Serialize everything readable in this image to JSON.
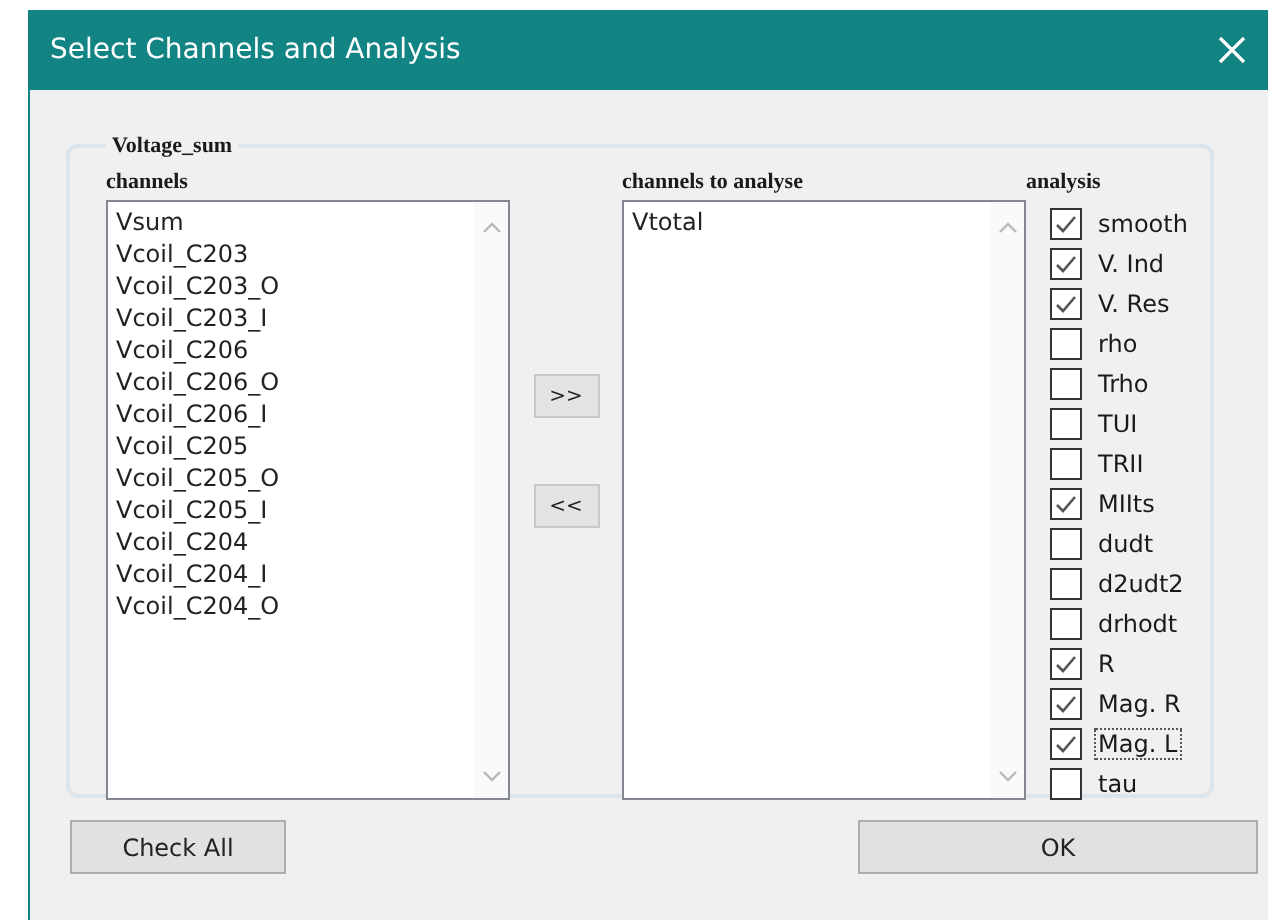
{
  "window": {
    "title": "Select Channels and Analysis"
  },
  "group": {
    "title": "Voltage_sum"
  },
  "channels": {
    "label": "channels",
    "items": [
      "Vsum",
      "Vcoil_C203",
      "Vcoil_C203_O",
      "Vcoil_C203_I",
      "Vcoil_C206",
      "Vcoil_C206_O",
      "Vcoil_C206_I",
      "Vcoil_C205",
      "Vcoil_C205_O",
      "Vcoil_C205_I",
      "Vcoil_C204",
      "Vcoil_C204_I",
      "Vcoil_C204_O"
    ]
  },
  "move_buttons": [
    ">>",
    "<<"
  ],
  "channels_to_analyse": {
    "label": "channels to analyse",
    "items": [
      "Vtotal"
    ]
  },
  "analysis": {
    "label": "analysis",
    "items": [
      {
        "label": "smooth",
        "checked": true,
        "focused": false
      },
      {
        "label": "V. Ind",
        "checked": true,
        "focused": false
      },
      {
        "label": "V. Res",
        "checked": true,
        "focused": false
      },
      {
        "label": "rho",
        "checked": false,
        "focused": false
      },
      {
        "label": "Trho",
        "checked": false,
        "focused": false
      },
      {
        "label": "TUI",
        "checked": false,
        "focused": false
      },
      {
        "label": "TRII",
        "checked": false,
        "focused": false
      },
      {
        "label": "MIIts",
        "checked": true,
        "focused": false
      },
      {
        "label": "dudt",
        "checked": false,
        "focused": false
      },
      {
        "label": "d2udt2",
        "checked": false,
        "focused": false
      },
      {
        "label": "drhodt",
        "checked": false,
        "focused": false
      },
      {
        "label": "R",
        "checked": true,
        "focused": false
      },
      {
        "label": "Mag. R",
        "checked": true,
        "focused": false
      },
      {
        "label": "Mag. L",
        "checked": true,
        "focused": true
      },
      {
        "label": "tau",
        "checked": false,
        "focused": false
      }
    ]
  },
  "buttons": [
    "Check All",
    "OK"
  ]
}
